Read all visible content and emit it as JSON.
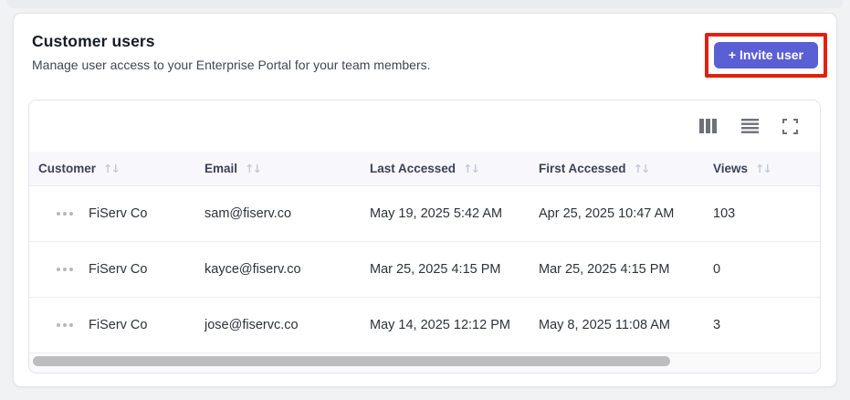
{
  "page": {
    "title": "Customer users",
    "subtitle": "Manage user access to your Enterprise Portal for your team members.",
    "invite_button_label": "+ Invite user"
  },
  "toolbar": {
    "icons": [
      "columns-icon",
      "row-density-icon",
      "fullscreen-icon"
    ]
  },
  "icons": {
    "sort": "↑↓"
  },
  "table": {
    "columns": [
      {
        "label": "Customer",
        "sortable": true
      },
      {
        "label": "Email",
        "sortable": true
      },
      {
        "label": "Last Accessed",
        "sortable": true
      },
      {
        "label": "First Accessed",
        "sortable": true
      },
      {
        "label": "Views",
        "sortable": true
      }
    ],
    "rows": [
      {
        "customer": "FiServ Co",
        "email": "sam@fiserv.co",
        "last_accessed": "May 19, 2025 5:42 AM",
        "first_accessed": "Apr 25, 2025 10:47 AM",
        "views": "103"
      },
      {
        "customer": "FiServ Co",
        "email": "kayce@fiserv.co",
        "last_accessed": "Mar 25, 2025 4:15 PM",
        "first_accessed": "Mar 25, 2025 4:15 PM",
        "views": "0"
      },
      {
        "customer": "FiServ Co",
        "email": "jose@fiservc.co",
        "last_accessed": "May 14, 2025 12:12 PM",
        "first_accessed": "May 8, 2025 11:08 AM",
        "views": "3"
      }
    ]
  },
  "colors": {
    "accent_button": "#5a5fd3",
    "annotation_highlight": "#e3200f",
    "header_row_bg": "#f8f8fc",
    "page_bg": "#f0f2f4"
  }
}
